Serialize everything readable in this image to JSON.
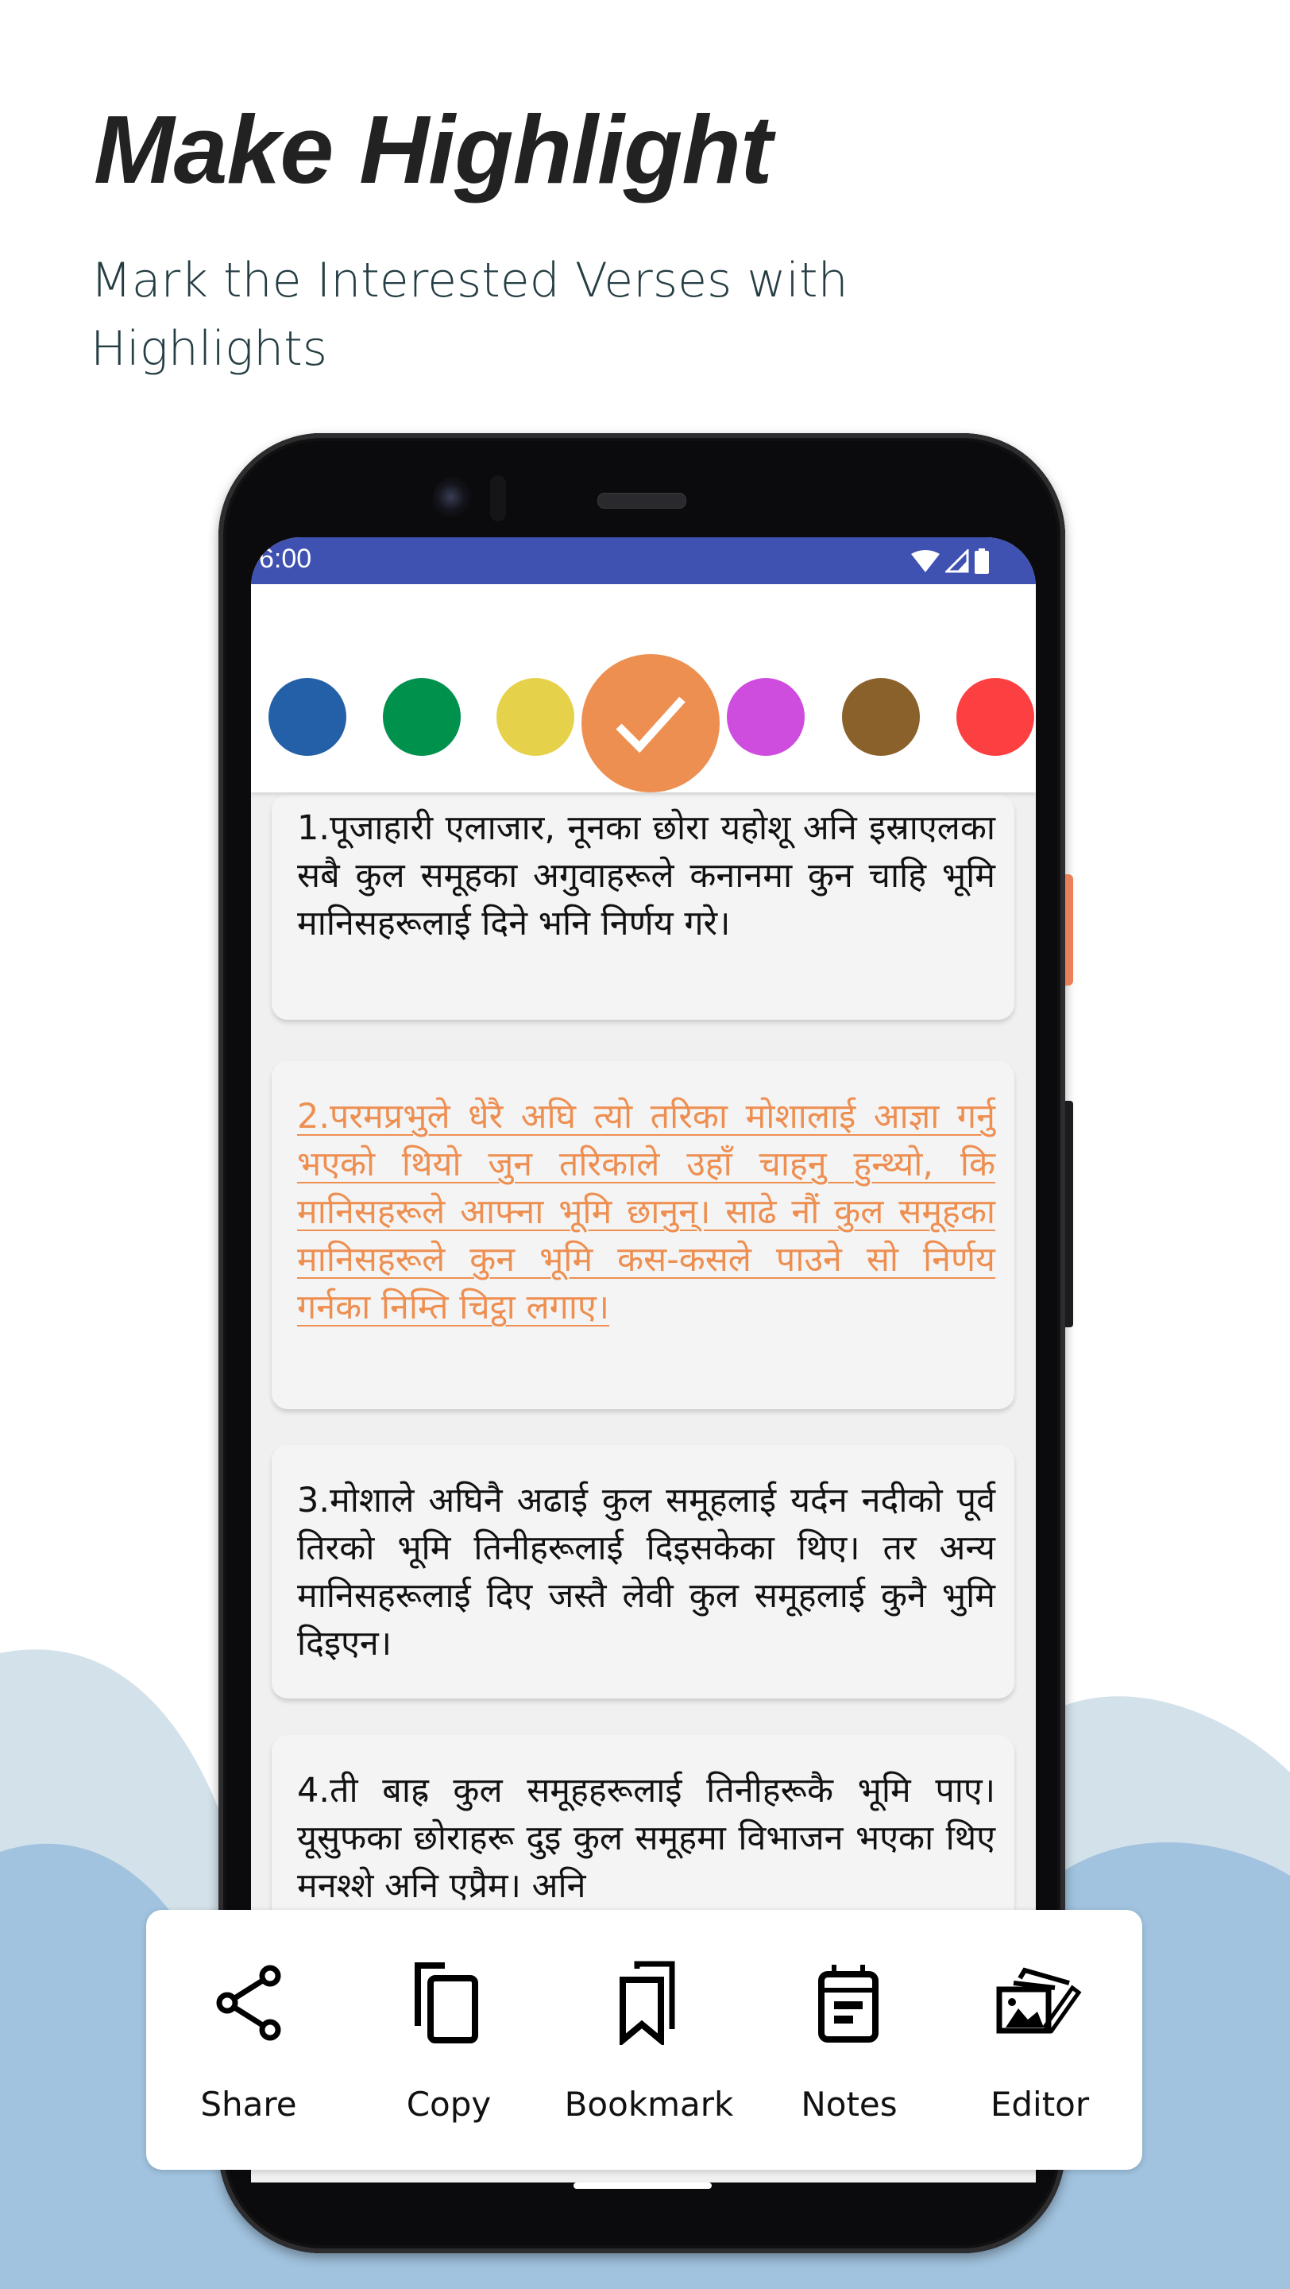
{
  "header": {
    "title": "Make Highlight",
    "subtitle": "Mark the Interested Verses with Highlights"
  },
  "statusbar": {
    "time": "6:00",
    "icons": [
      "wifi-icon",
      "signal-icon",
      "battery-icon"
    ]
  },
  "color_picker": {
    "selected_index": 3,
    "swatches": [
      {
        "name": "blue",
        "color": "#2460a7"
      },
      {
        "name": "green",
        "color": "#00924c"
      },
      {
        "name": "yellow",
        "color": "#e6d24a"
      },
      {
        "name": "orange",
        "color": "#ee8f52"
      },
      {
        "name": "magenta",
        "color": "#ce4ddf"
      },
      {
        "name": "brown",
        "color": "#8b612b"
      },
      {
        "name": "red",
        "color": "#fc4041"
      }
    ]
  },
  "verses": [
    {
      "text": "1.पूजाहारी एलाजार, नूनका छोरा यहोशू अनि इस्राएलका सबै कुल समूहका अगुवाहरूले कनानमा कुन चाहि भूमि मानिसहरूलाई दिने भनि निर्णय गरे।",
      "highlighted": false
    },
    {
      "text": "2.परमप्रभुले धेरै अघि त्यो तरिका मोशालाई आज्ञा गर्नु भएको थियो जुन तरिकाले उहाँ चाहनु हुन्थ्यो, कि मानिसहरूले आफ्ना भूमि छानुन्। साढे नौं कुल समूहका मानिसहरूले कुन भूमि कस-कसले पाउने सो निर्णय गर्नका निम्ति चिट्ठा लगाए।",
      "highlighted": true,
      "highlight_color": "#ee8f52"
    },
    {
      "text": "3.मोशाले अघिनै अढाई कुल समूहलाई यर्दन नदीको पूर्व तिरको भूमि तिनीहरूलाई दिइसकेका थिए। तर अन्य मानिसहरूलाई दिए जस्तै लेवी कुल समूहलाई कुनै भुमि दिइएन।",
      "highlighted": false
    },
    {
      "text": "4.ती बाह्र कुल समूहहरूलाई तिनीहरूकै भूमि पाए। यूसुफका छोराहरू दुइ कुल समूहमा विभाजन भएका थिए मनश्शे अनि एप्रैम। अनि",
      "highlighted": false
    }
  ],
  "actions": [
    {
      "label": "Share",
      "icon": "share-icon"
    },
    {
      "label": "Copy",
      "icon": "copy-icon"
    },
    {
      "label": "Bookmark",
      "icon": "bookmark-icon"
    },
    {
      "label": "Notes",
      "icon": "notes-icon"
    },
    {
      "label": "Editor",
      "icon": "image-editor-icon"
    }
  ],
  "colors": {
    "accent_orange": "#ee8f52",
    "statusbar_blue": "#3f51b1",
    "wave_light": "#d3e1ea",
    "wave_dark": "#a1c3df"
  }
}
